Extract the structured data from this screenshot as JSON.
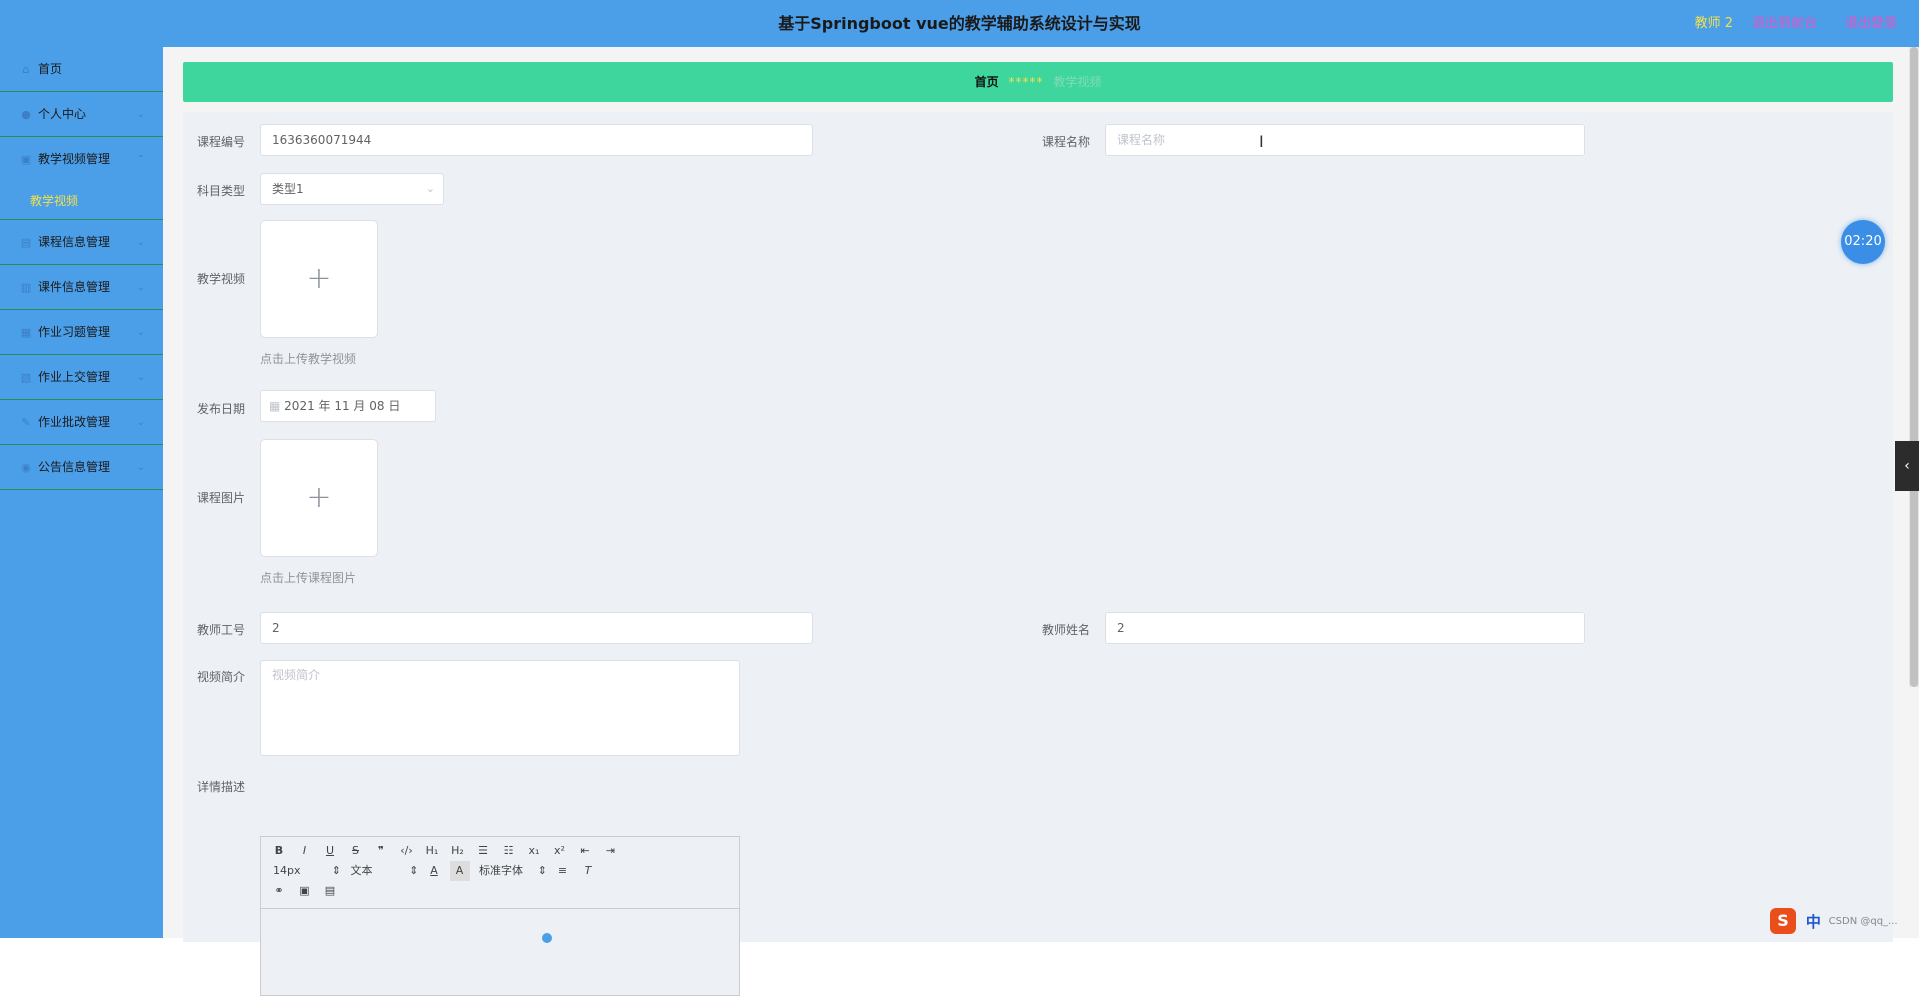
{
  "header": {
    "title": "基于Springboot vue的教学辅助系统设计与实现",
    "user": "教师 2",
    "back_link": "退出到前台",
    "logout_link": "退出登录"
  },
  "sidebar": {
    "items": [
      {
        "label": "首页",
        "icon": "home-icon"
      },
      {
        "label": "个人中心",
        "icon": "user-icon"
      },
      {
        "label": "教学视频管理",
        "icon": "video-icon"
      },
      {
        "label": "教学视频",
        "icon": "",
        "submenu": true
      },
      {
        "label": "课程信息管理",
        "icon": "course-icon"
      },
      {
        "label": "课件信息管理",
        "icon": "courseware-icon"
      },
      {
        "label": "作业习题管理",
        "icon": "exercise-icon"
      },
      {
        "label": "作业上交管理",
        "icon": "upload-icon"
      },
      {
        "label": "作业批改管理",
        "icon": "review-icon"
      },
      {
        "label": "公告信息管理",
        "icon": "notice-icon"
      }
    ]
  },
  "breadcrumb": {
    "home": "首页",
    "separator": "*****",
    "current": "教学视频"
  },
  "form": {
    "course_no_label": "课程编号",
    "course_no_value": "1636360071944",
    "course_name_label": "课程名称",
    "course_name_placeholder": "课程名称",
    "subject_type_label": "科目类型",
    "subject_type_value": "类型1",
    "video_label": "教学视频",
    "video_tip": "点击上传教学视频",
    "publish_date_label": "发布日期",
    "publish_date_value": "2021 年 11 月 08 日",
    "course_image_label": "课程图片",
    "course_image_tip": "点击上传课程图片",
    "teacher_no_label": "教师工号",
    "teacher_no_value": "2",
    "teacher_name_label": "教师姓名",
    "teacher_name_value": "2",
    "intro_label": "视频简介",
    "intro_placeholder": "视频简介",
    "detail_label": "详情描述"
  },
  "editor": {
    "row1": [
      "B",
      "I",
      "U",
      "S",
      "❞",
      "‹/›",
      "H₁",
      "H₂",
      "☰",
      "☷",
      "x₁",
      "x²",
      "⇤",
      "⇥"
    ],
    "font_size": "14px",
    "block_type": "文本",
    "font_family": "标准字体",
    "row3": [
      "link-icon",
      "image-icon",
      "video-icon"
    ]
  },
  "timer": "02:20",
  "tray": {
    "logo": "S",
    "ime": "中",
    "watermark": "CSDN @qq_..."
  }
}
